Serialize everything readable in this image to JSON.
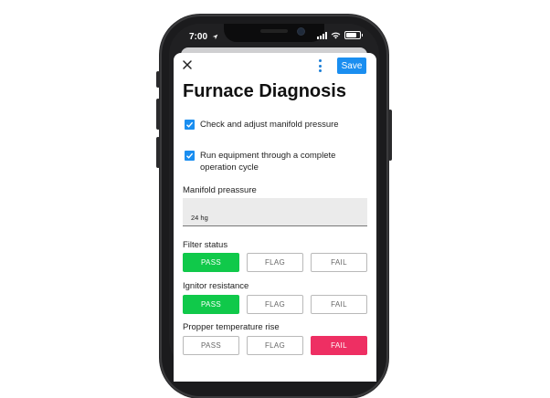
{
  "status_bar": {
    "time": "7:00"
  },
  "header": {
    "save_label": "Save"
  },
  "page": {
    "title": "Furnace Diagnosis"
  },
  "checklist": [
    {
      "label": "Check and adjust manifold pressure",
      "checked": true
    },
    {
      "label": "Run equipment through a complete operation cycle",
      "checked": true
    }
  ],
  "manifold": {
    "label": "Manifold preassure",
    "value": "24 hg"
  },
  "groups": [
    {
      "label": "Filter status",
      "options": [
        "PASS",
        "FLAG",
        "FAIL"
      ],
      "selected": "PASS"
    },
    {
      "label": "Ignitor resistance",
      "options": [
        "PASS",
        "FLAG",
        "FAIL"
      ],
      "selected": "PASS"
    },
    {
      "label": "Propper temperature rise",
      "options": [
        "PASS",
        "FLAG",
        "FAIL"
      ],
      "selected": "FAIL"
    }
  ],
  "colors": {
    "accent": "#1a8ef0",
    "pass": "#10c94a",
    "fail": "#ee2f63"
  },
  "icons": [
    "close-icon",
    "more-vertical-icon",
    "checkmark-icon",
    "location-arrow-icon",
    "wifi-icon",
    "battery-icon",
    "signal-icon"
  ]
}
